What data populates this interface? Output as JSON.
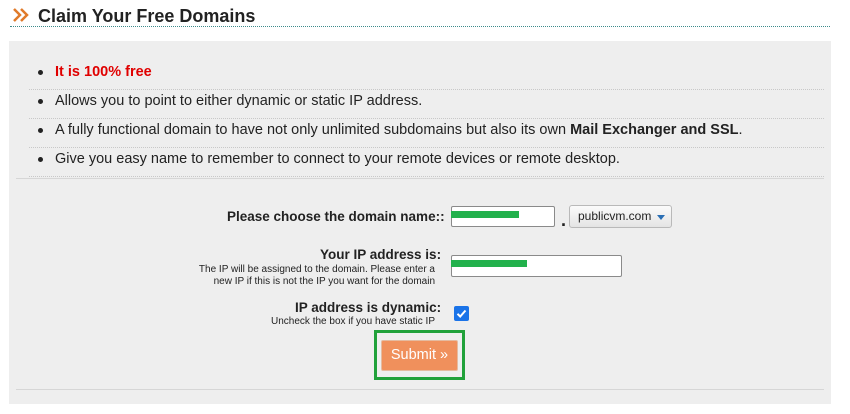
{
  "header": {
    "icon": "double-chevron-right-icon",
    "title": "Claim Your Free Domains",
    "accent_color": "#e07a2a",
    "rule_color": "#3d8b8b"
  },
  "features": {
    "items": [
      {
        "text": "It is 100% free",
        "color": "#e00000"
      },
      {
        "text": "Allows you to point to either dynamic or static IP address."
      },
      {
        "text_before": "A fully functional domain to have not only unlimited subdomains but also its own ",
        "strong": "Mail Exchanger and SSL",
        "text_after": "."
      },
      {
        "text": "Give you easy name to remember to connect to your remote devices or remote desktop."
      }
    ]
  },
  "form": {
    "domain": {
      "label": "Please choose the domain name:",
      "label_suffix": ":",
      "value": "",
      "separator": ".",
      "tld_selected": "publicvm.com"
    },
    "ip": {
      "label": "Your IP address is",
      "label_suffix": ":",
      "hint_line1": "The IP will be assigned to the domain. Please enter a",
      "hint_line2": "new IP if this is not the IP you want for the domain",
      "value": ""
    },
    "dynamic": {
      "label": "IP address is dynamic",
      "label_suffix": ":",
      "hint": "Uncheck the box if you have static IP",
      "checked": true
    },
    "submit_label": "Submit »",
    "submit_color": "#f0905c",
    "highlight_color": "#21a13a"
  }
}
